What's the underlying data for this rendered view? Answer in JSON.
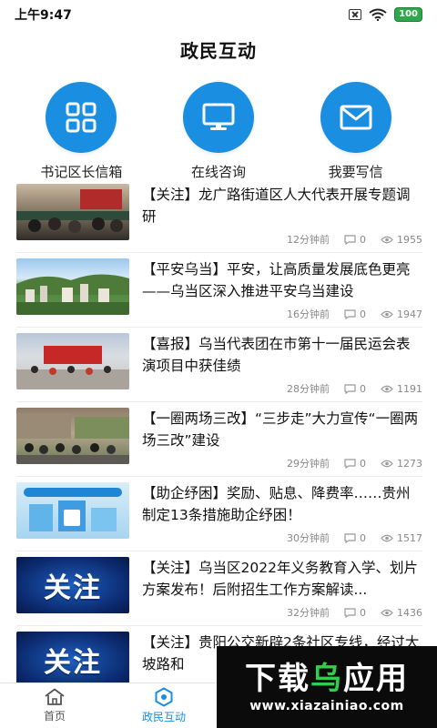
{
  "status_bar": {
    "time": "上午9:47",
    "battery": "100"
  },
  "header": {
    "title": "政民互动"
  },
  "actions": [
    {
      "label": "书记区长信箱",
      "icon": "grid-icon"
    },
    {
      "label": "在线咨询",
      "icon": "monitor-icon"
    },
    {
      "label": "我要写信",
      "icon": "envelope-icon"
    }
  ],
  "news": [
    {
      "title": "【关注】龙广路街道区人大代表开展专题调研",
      "time": "12分钟前",
      "comments": "0",
      "views": "1955"
    },
    {
      "title": "【平安乌当】平安，让高质量发展底色更亮——乌当区深入推进平安乌当建设",
      "time": "16分钟前",
      "comments": "0",
      "views": "1947"
    },
    {
      "title": "【喜报】乌当代表团在市第十一届民运会表演项目中获佳绩",
      "time": "28分钟前",
      "comments": "0",
      "views": "1191"
    },
    {
      "title": "【一圈两场三改】“三步走”大力宣传“一圈两场三改”建设",
      "time": "29分钟前",
      "comments": "0",
      "views": "1273"
    },
    {
      "title": "【助企纾困】奖励、贴息、降费率……贵州制定13条措施助企纾困！",
      "time": "30分钟前",
      "comments": "0",
      "views": "1517"
    },
    {
      "title": "【关注】乌当区2022年义务教育入学、划片方案发布！后附招生工作方案解读...",
      "time": "32分钟前",
      "comments": "0",
      "views": "1436",
      "thumb_text": "关注"
    },
    {
      "title": "【关注】贵阳公交新辟2条社区专线，经过大坡路和",
      "thumb_text": "关注"
    }
  ],
  "tabs": [
    {
      "label": "首页"
    },
    {
      "label": "政民互动"
    }
  ],
  "watermark": {
    "main_a": "下载",
    "main_b": "乌",
    "main_c": "应用",
    "url": "www.xiazainiao.com"
  },
  "colors": {
    "accent": "#1a8ee1",
    "watermark_green": "#2fcf4b"
  }
}
